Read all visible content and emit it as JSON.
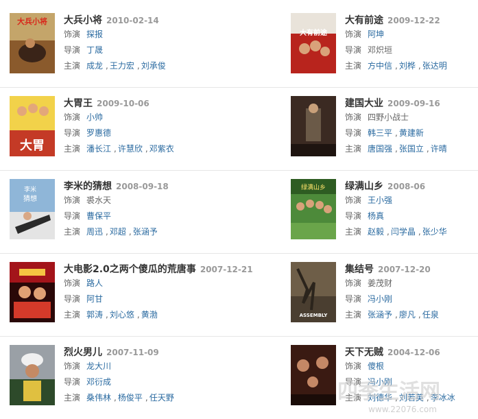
{
  "labels": {
    "role": "饰演",
    "director": "导演",
    "star": "主演"
  },
  "colors": {
    "title": "#333333",
    "date": "#999999",
    "link": "#2a6aa0",
    "label": "#666666",
    "divider": "#e6e6e6"
  },
  "movies": [
    {
      "title": "大兵小将",
      "date": "2010-02-14",
      "role": "探报",
      "role_link": true,
      "director": "丁晟",
      "stars": [
        "成龙",
        "王力宏",
        "刘承俊"
      ],
      "poster_text": "大兵小将"
    },
    {
      "title": "大有前途",
      "date": "2009-12-22",
      "role": "阿坤",
      "role_link": true,
      "director": "邓炽垣",
      "director_link": false,
      "stars": [
        "方中信",
        "刘桦",
        "张达明"
      ],
      "poster_text": "大有前途"
    },
    {
      "title": "大胃王",
      "date": "2009-10-06",
      "role": "小帅",
      "role_link": true,
      "director": "罗惠德",
      "stars": [
        "潘长江",
        "许慧欣",
        "邓紫衣"
      ],
      "poster_text": "大胃"
    },
    {
      "title": "建国大业",
      "date": "2009-09-16",
      "role": "四野小战士",
      "role_link": false,
      "director": "韩三平",
      "director2": "黄建新",
      "stars": [
        "唐国强",
        "张国立",
        "许晴"
      ],
      "poster_text": "建国大业"
    },
    {
      "title": "李米的猜想",
      "date": "2008-09-18",
      "role": "裘水天",
      "role_link": false,
      "director": "曹保平",
      "stars": [
        "周迅",
        "邓超",
        "张涵予"
      ],
      "poster_text": "李米的猜想"
    },
    {
      "title": "绿满山乡",
      "date": "2008-06",
      "role": "王小强",
      "role_link": true,
      "director": "杨真",
      "stars": [
        "赵毅",
        "闫学晶",
        "张少华"
      ],
      "poster_text": "绿满山乡"
    },
    {
      "title": "大电影2.0之两个傻瓜的荒唐事",
      "date": "2007-12-21",
      "role": "路人",
      "role_link": true,
      "director": "阿甘",
      "stars": [
        "郭涛",
        "刘心悠",
        "黄渤"
      ],
      "poster_text": ""
    },
    {
      "title": "集结号",
      "date": "2007-12-20",
      "role": "姜茂财",
      "role_link": false,
      "director": "冯小刚",
      "stars": [
        "张涵予",
        "廖凡",
        "任泉"
      ],
      "poster_text": "ASSEMBLY"
    },
    {
      "title": "烈火男儿",
      "date": "2007-11-09",
      "role": "龙大川",
      "role_link": true,
      "director": "邓衍成",
      "stars": [
        "桑伟林",
        "杨俊平",
        "任天野"
      ],
      "poster_text": ""
    },
    {
      "title": "天下无贼",
      "date": "2004-12-06",
      "role": "傻根",
      "role_link": true,
      "director": "冯小刚",
      "stars": [
        "刘德华",
        "刘若英",
        "李冰冰"
      ],
      "poster_text": ""
    }
  ],
  "watermark": {
    "text": "四季生活网",
    "url_text": "www.22076.com"
  }
}
